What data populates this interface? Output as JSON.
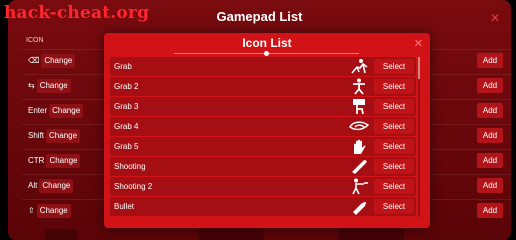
{
  "watermark": "hack-cheat.org",
  "panel": {
    "title": "Gamepad List",
    "close_glyph": "✕",
    "header_icon": "ICON",
    "rows": [
      {
        "key": "⌫",
        "label": "Change",
        "add": "Add"
      },
      {
        "key": "⇆",
        "label": "Change",
        "add": "Add"
      },
      {
        "key": "Enter",
        "label": "Change",
        "add": "Add"
      },
      {
        "key": "Shift",
        "label": "Change",
        "add": "Add"
      },
      {
        "key": "CTR",
        "label": "Change",
        "add": "Add"
      },
      {
        "key": "Alt",
        "label": "Change",
        "add": "Add"
      },
      {
        "key": "⇧",
        "label": "Change",
        "add": "Add"
      }
    ]
  },
  "dialog": {
    "title": "Icon List",
    "close_glyph": "✕",
    "select_label": "Select",
    "items": [
      {
        "name": "Grab",
        "icon": "grab-icon"
      },
      {
        "name": "Grab 2",
        "icon": "grab-2-icon"
      },
      {
        "name": "Grab 3",
        "icon": "grab-3-icon"
      },
      {
        "name": "Grab 4",
        "icon": "grab-4-icon"
      },
      {
        "name": "Grab 5",
        "icon": "grab-5-icon"
      },
      {
        "name": "Shooting",
        "icon": "shooting-icon"
      },
      {
        "name": "Shooting 2",
        "icon": "shooting-2-icon"
      },
      {
        "name": "Bullet",
        "icon": "bullet-icon"
      }
    ]
  },
  "colors": {
    "accent": "#d11318",
    "panel": "#7a0b0f",
    "row": "#a50e13",
    "watermark": "#ff2630"
  }
}
